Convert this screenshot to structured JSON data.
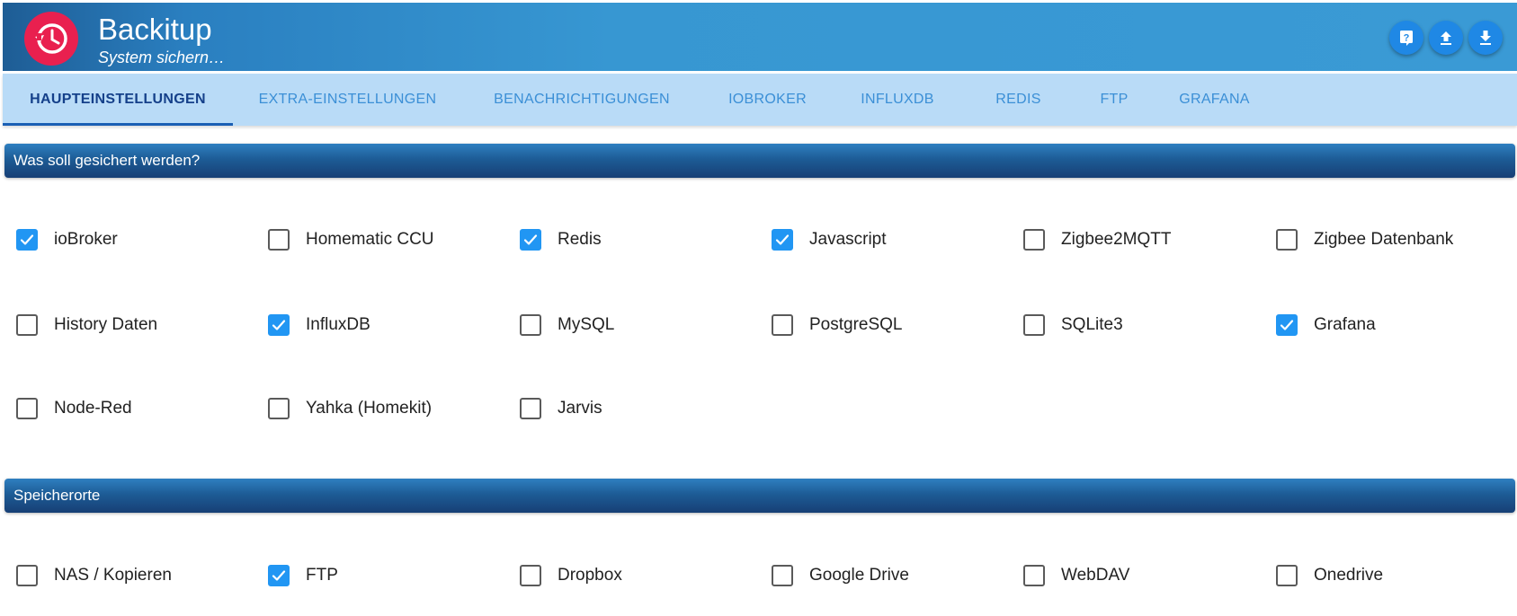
{
  "app": {
    "title": "Backitup",
    "subtitle": "System sichern…",
    "accent": "#3a9ad5",
    "logo_color": "#e9204f",
    "actions": [
      {
        "icon": "help-icon"
      },
      {
        "icon": "upload-icon"
      },
      {
        "icon": "download-icon"
      }
    ]
  },
  "tabs": [
    {
      "label": "HAUPTEINSTELLUNGEN",
      "active": true
    },
    {
      "label": "EXTRA-EINSTELLUNGEN",
      "active": false
    },
    {
      "label": "BENACHRICHTIGUNGEN",
      "active": false
    },
    {
      "label": "IOBROKER",
      "active": false
    },
    {
      "label": "INFLUXDB",
      "active": false
    },
    {
      "label": "REDIS",
      "active": false
    },
    {
      "label": "FTP",
      "active": false
    },
    {
      "label": "GRAFANA",
      "active": false
    }
  ],
  "sections": {
    "backup": {
      "title": "Was soll gesichert werden?",
      "items": [
        {
          "label": "ioBroker",
          "checked": true
        },
        {
          "label": "Homematic CCU",
          "checked": false
        },
        {
          "label": "Redis",
          "checked": true
        },
        {
          "label": "Javascript",
          "checked": true
        },
        {
          "label": "Zigbee2MQTT",
          "checked": false
        },
        {
          "label": "Zigbee Datenbank",
          "checked": false
        },
        {
          "label": "History Daten",
          "checked": false
        },
        {
          "label": "InfluxDB",
          "checked": true
        },
        {
          "label": "MySQL",
          "checked": false
        },
        {
          "label": "PostgreSQL",
          "checked": false
        },
        {
          "label": "SQLite3",
          "checked": false
        },
        {
          "label": "Grafana",
          "checked": true
        },
        {
          "label": "Node-Red",
          "checked": false
        },
        {
          "label": "Yahka (Homekit)",
          "checked": false
        },
        {
          "label": "Jarvis",
          "checked": false
        }
      ]
    },
    "storage": {
      "title": "Speicherorte",
      "items": [
        {
          "label": "NAS / Kopieren",
          "checked": false
        },
        {
          "label": "FTP",
          "checked": true
        },
        {
          "label": "Dropbox",
          "checked": false
        },
        {
          "label": "Google Drive",
          "checked": false
        },
        {
          "label": "WebDAV",
          "checked": false
        },
        {
          "label": "Onedrive",
          "checked": false
        }
      ]
    }
  }
}
